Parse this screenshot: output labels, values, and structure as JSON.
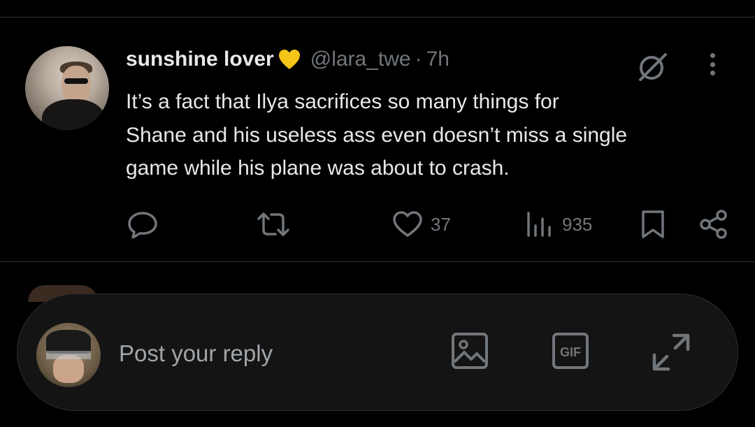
{
  "post": {
    "display_name": "sunshine lover",
    "name_emoji": "yellow-heart",
    "handle": "@lara_twe",
    "separator": "·",
    "time": "7h",
    "text": "It’s a fact that Ilya sacrifices so many things for\nShane and his useless ass even doesn’t miss a single\ngame while his plane was about to crash.",
    "actions": {
      "replies": "",
      "reposts": "",
      "likes": "37",
      "views": "935"
    }
  },
  "composer": {
    "placeholder": "Post your reply"
  },
  "colors": {
    "background": "#000000",
    "text": "#e7e9ea",
    "muted": "#71767b",
    "heart": "#f5c518"
  }
}
